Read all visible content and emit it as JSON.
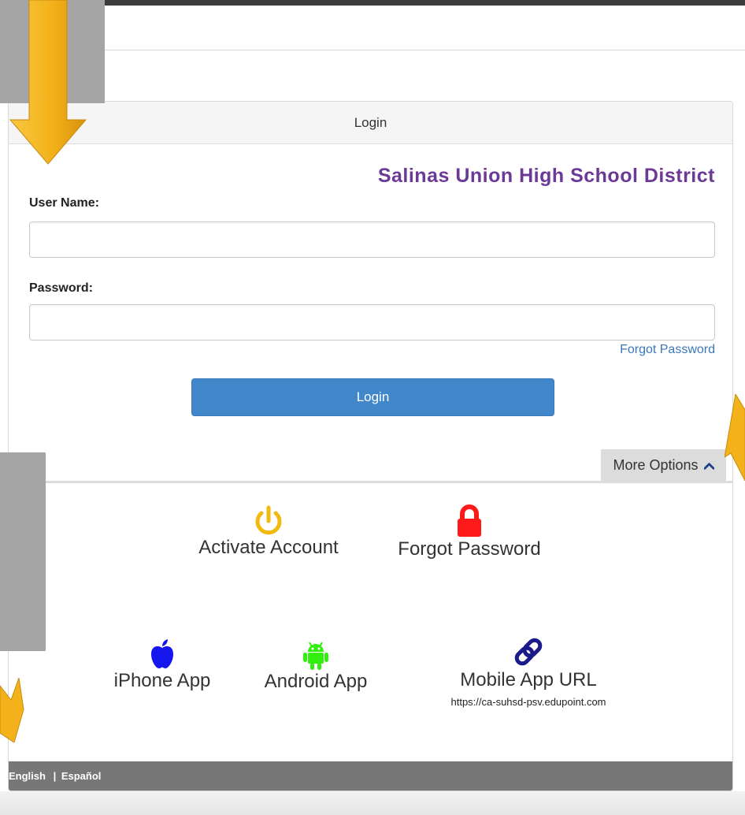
{
  "panel": {
    "title": "Login",
    "district_name": "Salinas Union High School District",
    "username_label": "User Name:",
    "username_value": "",
    "password_label": "Password:",
    "password_value": "",
    "forgot_password_link": "Forgot Password",
    "login_button": "Login",
    "more_options_tab": "More Options",
    "options": {
      "activate_account": "Activate Account",
      "forgot_password": "Forgot Password",
      "iphone_app": "iPhone App",
      "android_app": "Android App",
      "mobile_app_url": "Mobile App URL",
      "mobile_app_url_value": "https://ca-suhsd-psv.edupoint.com"
    }
  },
  "footer": {
    "lang_english": "English",
    "separator": "|",
    "lang_spanish": "Español"
  },
  "colors": {
    "district_purple": "#6c3a96",
    "button_blue": "#4287c9",
    "power_icon": "#f2b90f",
    "lock_icon": "#ff1a1a",
    "apple_icon": "#1515ee",
    "android_icon": "#33ee11",
    "link_icon": "#1a1a8a",
    "annotation_arrow": "#f6b81f"
  },
  "icons": {
    "power": "power-icon",
    "lock": "lock-icon",
    "apple": "apple-icon",
    "android": "android-icon",
    "link": "link-icon",
    "chevron": "chevron-up-icon"
  }
}
